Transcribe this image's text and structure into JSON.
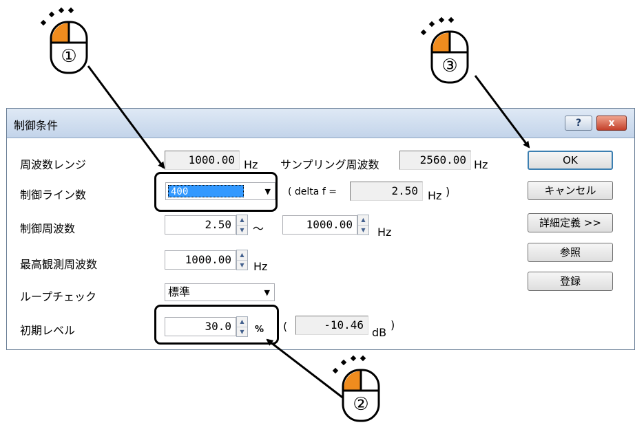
{
  "dialog": {
    "title": "制御条件",
    "help_label": "?",
    "close_label": "x"
  },
  "form": {
    "freq_range_label": "周波数レンジ",
    "freq_range_value": "1000.00",
    "freq_range_unit": "Hz",
    "sampling_label": "サンプリング周波数",
    "sampling_value": "2560.00",
    "sampling_unit": "Hz",
    "lines_label": "制御ライン数",
    "lines_value": "400",
    "delta_prefix": "( delta f =",
    "delta_value": "2.50",
    "delta_unit": "Hz",
    "delta_suffix": ")",
    "control_freq_label": "制御周波数",
    "control_freq_min": "2.50",
    "tilde": "～",
    "control_freq_max": "1000.00",
    "control_freq_unit": "Hz",
    "max_obs_label": "最高観測周波数",
    "max_obs_value": "1000.00",
    "max_obs_unit": "Hz",
    "loop_label": "ループチェック",
    "loop_value": "標準",
    "initial_label": "初期レベル",
    "initial_value": "30.0",
    "initial_unit": "%",
    "db_prefix": "(",
    "db_value": "-10.46",
    "db_unit": "dB",
    "db_suffix": ")"
  },
  "buttons": {
    "ok": "OK",
    "cancel": "キャンセル",
    "detail": "詳細定義 >>",
    "browse": "参照",
    "register": "登録"
  },
  "annotations": {
    "step1": "①",
    "step2": "②",
    "step3": "③"
  },
  "colors": {
    "mouse_button": "#f08c1e",
    "highlight_border": "#000000",
    "selection": "#3399ff"
  }
}
